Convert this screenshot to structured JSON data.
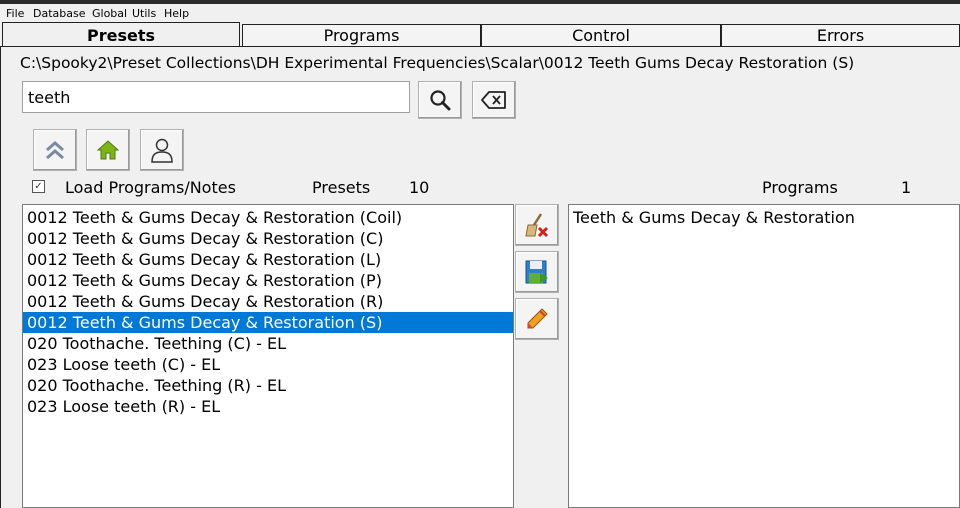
{
  "menu": [
    "File",
    "Database",
    "Global",
    "Utils",
    "Help"
  ],
  "tabs": [
    "Presets",
    "Programs",
    "Control",
    "Errors"
  ],
  "path": "C:\\Spooky2\\Preset Collections\\DH Experimental Frequencies\\Scalar\\0012 Teeth  Gums Decay Restoration (S)",
  "search": {
    "value": "teeth"
  },
  "load_checkbox": {
    "checked": true,
    "label": "Load Programs/Notes"
  },
  "presets": {
    "label": "Presets",
    "count": "10"
  },
  "programs": {
    "label": "Programs",
    "count": "1"
  },
  "preset_list": [
    "0012 Teeth & Gums Decay & Restoration (Coil)",
    "0012 Teeth & Gums Decay & Restoration (C)",
    "0012 Teeth & Gums Decay & Restoration (L)",
    "0012 Teeth & Gums Decay & Restoration (P)",
    "0012 Teeth & Gums Decay & Restoration (R)",
    "0012 Teeth & Gums Decay & Restoration (S)",
    "020 Toothache. Teething (C) - EL",
    "023 Loose teeth (C) - EL",
    "020 Toothache. Teething (R) - EL",
    "023 Loose teeth (R) - EL"
  ],
  "selected_index": 5,
  "program_list": [
    "Teeth & Gums Decay & Restoration"
  ],
  "icons": {
    "search": "search-icon",
    "clear": "backspace-icon",
    "up": "double-chevron-up-icon",
    "home": "home-icon",
    "user": "user-icon",
    "delete": "broom-delete-icon",
    "save": "save-icon",
    "edit": "pencil-icon"
  },
  "colors": {
    "selection": "#0078d7",
    "home": "#7cb518"
  }
}
